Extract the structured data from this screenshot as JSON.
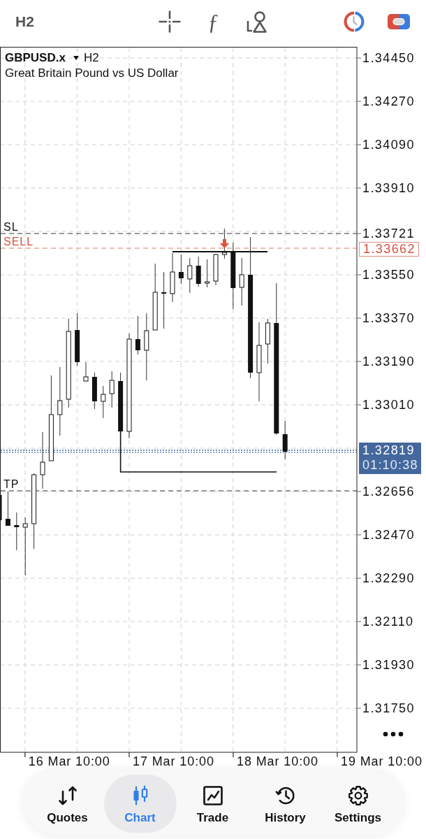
{
  "top_bar": {
    "timeframe": "H2",
    "function_glyph": "ƒ"
  },
  "chart": {
    "symbol": "GBPUSD.x",
    "timeframe": "H2",
    "description": "Great Britain Pound vs US Dollar",
    "levels": [
      {
        "label": "SL",
        "kind": "stop_loss"
      },
      {
        "label": "SELL",
        "kind": "order"
      },
      {
        "label": "TP",
        "kind": "take_profit"
      }
    ]
  },
  "price_axis": [
    {
      "text": "1.34450",
      "kind": "tick"
    },
    {
      "text": "1.34270",
      "kind": "tick"
    },
    {
      "text": "1.34090",
      "kind": "tick"
    },
    {
      "text": "1.33910",
      "kind": "tick"
    },
    {
      "text": "1.33721",
      "kind": "tick"
    },
    {
      "text": "1.33662",
      "kind": "order"
    },
    {
      "text": "1.33550",
      "kind": "tick"
    },
    {
      "text": "1.33370",
      "kind": "tick"
    },
    {
      "text": "1.33190",
      "kind": "tick"
    },
    {
      "text": "1.33010",
      "kind": "tick"
    },
    {
      "text": "1.32819",
      "kind": "current",
      "timer": "01:10:38"
    },
    {
      "text": "1.32656",
      "kind": "tick"
    },
    {
      "text": "1.32470",
      "kind": "tick"
    },
    {
      "text": "1.32290",
      "kind": "tick"
    },
    {
      "text": "1.32110",
      "kind": "tick"
    },
    {
      "text": "1.31930",
      "kind": "tick"
    },
    {
      "text": "1.31750",
      "kind": "tick"
    }
  ],
  "time_axis": [
    "16 Mar 10:00",
    "17 Mar 10:00",
    "18 Mar 10:00",
    "19 Mar 10:00"
  ],
  "tab_bar": [
    {
      "label": "Quotes",
      "selected": false
    },
    {
      "label": "Chart",
      "selected": true
    },
    {
      "label": "Trade",
      "selected": false
    },
    {
      "label": "History",
      "selected": false
    },
    {
      "label": "Settings",
      "selected": false
    }
  ]
}
